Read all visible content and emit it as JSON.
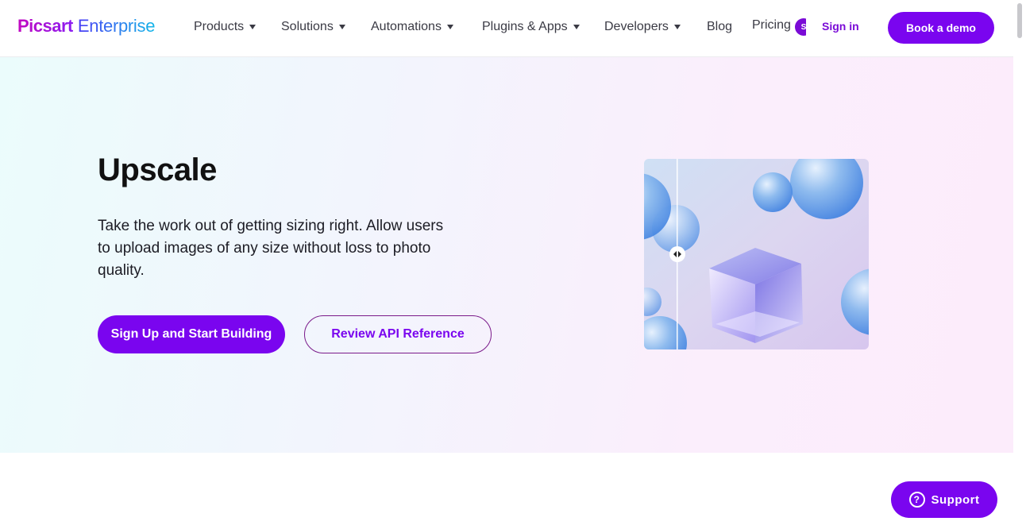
{
  "header": {
    "logo": {
      "brand": "Picsart",
      "product": "Enterprise"
    },
    "nav": [
      {
        "label": "Products"
      },
      {
        "label": "Solutions"
      },
      {
        "label": "Automations"
      },
      {
        "label": "Plugins & Apps"
      },
      {
        "label": "Developers"
      },
      {
        "label": "Blog"
      },
      {
        "label": "Pricing"
      }
    ],
    "pricing_badge": "S",
    "signin_label": "Sign in",
    "book_demo_label": "Book a demo"
  },
  "hero": {
    "title": "Upscale",
    "description": "Take the work out of getting sizing right. Allow users to upload images of any size without loss to photo quality.",
    "primary_cta": "Sign Up and Start Building",
    "secondary_cta": "Review API Reference"
  },
  "support": {
    "label": "Support",
    "icon_glyph": "?"
  },
  "colors": {
    "accent": "#7a05ef",
    "logo_gradient_start": "#c209c1",
    "logo_gradient_end": "#13b6e8"
  }
}
